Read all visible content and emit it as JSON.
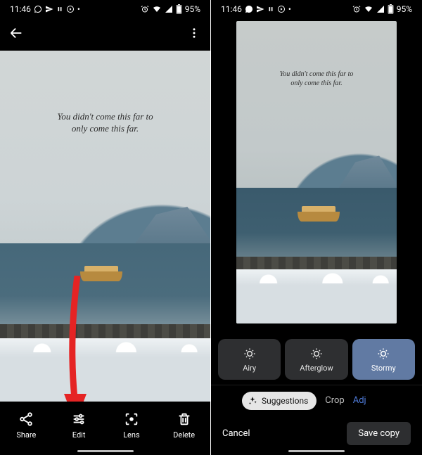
{
  "status": {
    "time": "11:46",
    "battery": "95%"
  },
  "quote": {
    "line1": "You didn't come this far to",
    "line2": "only come this far."
  },
  "left": {
    "actions": {
      "share": "Share",
      "edit": "Edit",
      "lens": "Lens",
      "delete": "Delete"
    }
  },
  "right": {
    "filters": {
      "airy": "Airy",
      "afterglow": "Afterglow",
      "stormy": "Stormy"
    },
    "tabs": {
      "suggestions": "Suggestions",
      "crop": "Crop",
      "adjust": "Adj"
    },
    "cancel": "Cancel",
    "save": "Save copy"
  }
}
